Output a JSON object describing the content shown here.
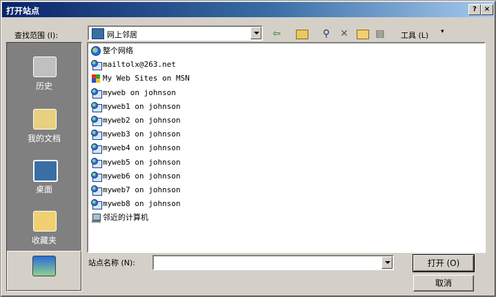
{
  "dialog": {
    "title": "打开站点",
    "help_glyph": "?",
    "close_glyph": "×"
  },
  "lookin": {
    "label": "查找范围 (I):",
    "value": "网上邻居"
  },
  "toolbar": {
    "tools_label": "工具 (L)"
  },
  "places": [
    {
      "label": "历史",
      "icon": "history-icon"
    },
    {
      "label": "我的文档",
      "icon": "my-documents-icon"
    },
    {
      "label": "桌面",
      "icon": "desktop-icon"
    },
    {
      "label": "收藏夹",
      "icon": "favorites-icon"
    },
    {
      "label": "",
      "icon": "network-places-icon"
    }
  ],
  "files": [
    {
      "name": "整个网络",
      "icon": "entire-network-icon"
    },
    {
      "name": "mailtolx@263.net",
      "icon": "web-folder-icon"
    },
    {
      "name": "My Web Sites on MSN",
      "icon": "msn-icon"
    },
    {
      "name": "myweb on johnson",
      "icon": "web-folder-icon"
    },
    {
      "name": "myweb1 on johnson",
      "icon": "web-folder-icon"
    },
    {
      "name": "myweb2 on johnson",
      "icon": "web-folder-icon"
    },
    {
      "name": "myweb3 on johnson",
      "icon": "web-folder-icon"
    },
    {
      "name": "myweb4 on johnson",
      "icon": "web-folder-icon"
    },
    {
      "name": "myweb5 on johnson",
      "icon": "web-folder-icon"
    },
    {
      "name": "myweb6 on johnson",
      "icon": "web-folder-icon"
    },
    {
      "name": "myweb7 on johnson",
      "icon": "web-folder-icon"
    },
    {
      "name": "myweb8 on johnson",
      "icon": "web-folder-icon"
    },
    {
      "name": "邻近的计算机",
      "icon": "computer-icon"
    }
  ],
  "sitename": {
    "label": "站点名称 (N):",
    "value": ""
  },
  "buttons": {
    "open": "打开 (O)",
    "cancel": "取消"
  }
}
